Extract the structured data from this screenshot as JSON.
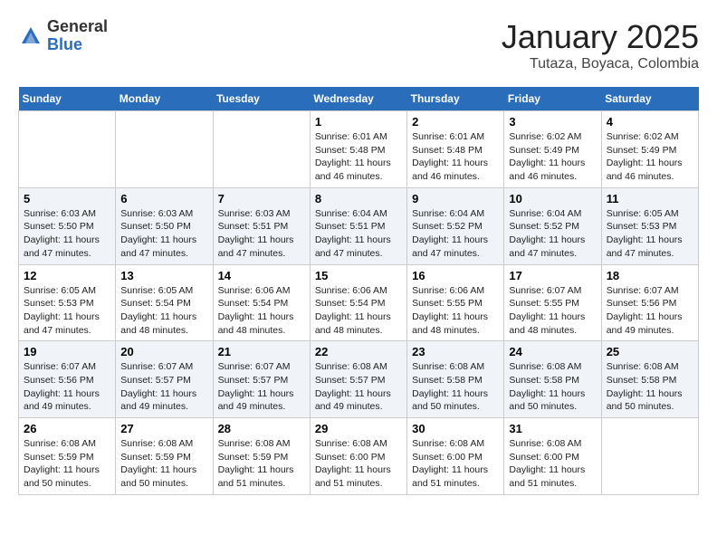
{
  "header": {
    "logo_general": "General",
    "logo_blue": "Blue",
    "month": "January 2025",
    "location": "Tutaza, Boyaca, Colombia"
  },
  "weekdays": [
    "Sunday",
    "Monday",
    "Tuesday",
    "Wednesday",
    "Thursday",
    "Friday",
    "Saturday"
  ],
  "weeks": [
    [
      {
        "day": "",
        "info": ""
      },
      {
        "day": "",
        "info": ""
      },
      {
        "day": "",
        "info": ""
      },
      {
        "day": "1",
        "info": "Sunrise: 6:01 AM\nSunset: 5:48 PM\nDaylight: 11 hours\nand 46 minutes."
      },
      {
        "day": "2",
        "info": "Sunrise: 6:01 AM\nSunset: 5:48 PM\nDaylight: 11 hours\nand 46 minutes."
      },
      {
        "day": "3",
        "info": "Sunrise: 6:02 AM\nSunset: 5:49 PM\nDaylight: 11 hours\nand 46 minutes."
      },
      {
        "day": "4",
        "info": "Sunrise: 6:02 AM\nSunset: 5:49 PM\nDaylight: 11 hours\nand 46 minutes."
      }
    ],
    [
      {
        "day": "5",
        "info": "Sunrise: 6:03 AM\nSunset: 5:50 PM\nDaylight: 11 hours\nand 47 minutes."
      },
      {
        "day": "6",
        "info": "Sunrise: 6:03 AM\nSunset: 5:50 PM\nDaylight: 11 hours\nand 47 minutes."
      },
      {
        "day": "7",
        "info": "Sunrise: 6:03 AM\nSunset: 5:51 PM\nDaylight: 11 hours\nand 47 minutes."
      },
      {
        "day": "8",
        "info": "Sunrise: 6:04 AM\nSunset: 5:51 PM\nDaylight: 11 hours\nand 47 minutes."
      },
      {
        "day": "9",
        "info": "Sunrise: 6:04 AM\nSunset: 5:52 PM\nDaylight: 11 hours\nand 47 minutes."
      },
      {
        "day": "10",
        "info": "Sunrise: 6:04 AM\nSunset: 5:52 PM\nDaylight: 11 hours\nand 47 minutes."
      },
      {
        "day": "11",
        "info": "Sunrise: 6:05 AM\nSunset: 5:53 PM\nDaylight: 11 hours\nand 47 minutes."
      }
    ],
    [
      {
        "day": "12",
        "info": "Sunrise: 6:05 AM\nSunset: 5:53 PM\nDaylight: 11 hours\nand 47 minutes."
      },
      {
        "day": "13",
        "info": "Sunrise: 6:05 AM\nSunset: 5:54 PM\nDaylight: 11 hours\nand 48 minutes."
      },
      {
        "day": "14",
        "info": "Sunrise: 6:06 AM\nSunset: 5:54 PM\nDaylight: 11 hours\nand 48 minutes."
      },
      {
        "day": "15",
        "info": "Sunrise: 6:06 AM\nSunset: 5:54 PM\nDaylight: 11 hours\nand 48 minutes."
      },
      {
        "day": "16",
        "info": "Sunrise: 6:06 AM\nSunset: 5:55 PM\nDaylight: 11 hours\nand 48 minutes."
      },
      {
        "day": "17",
        "info": "Sunrise: 6:07 AM\nSunset: 5:55 PM\nDaylight: 11 hours\nand 48 minutes."
      },
      {
        "day": "18",
        "info": "Sunrise: 6:07 AM\nSunset: 5:56 PM\nDaylight: 11 hours\nand 49 minutes."
      }
    ],
    [
      {
        "day": "19",
        "info": "Sunrise: 6:07 AM\nSunset: 5:56 PM\nDaylight: 11 hours\nand 49 minutes."
      },
      {
        "day": "20",
        "info": "Sunrise: 6:07 AM\nSunset: 5:57 PM\nDaylight: 11 hours\nand 49 minutes."
      },
      {
        "day": "21",
        "info": "Sunrise: 6:07 AM\nSunset: 5:57 PM\nDaylight: 11 hours\nand 49 minutes."
      },
      {
        "day": "22",
        "info": "Sunrise: 6:08 AM\nSunset: 5:57 PM\nDaylight: 11 hours\nand 49 minutes."
      },
      {
        "day": "23",
        "info": "Sunrise: 6:08 AM\nSunset: 5:58 PM\nDaylight: 11 hours\nand 50 minutes."
      },
      {
        "day": "24",
        "info": "Sunrise: 6:08 AM\nSunset: 5:58 PM\nDaylight: 11 hours\nand 50 minutes."
      },
      {
        "day": "25",
        "info": "Sunrise: 6:08 AM\nSunset: 5:58 PM\nDaylight: 11 hours\nand 50 minutes."
      }
    ],
    [
      {
        "day": "26",
        "info": "Sunrise: 6:08 AM\nSunset: 5:59 PM\nDaylight: 11 hours\nand 50 minutes."
      },
      {
        "day": "27",
        "info": "Sunrise: 6:08 AM\nSunset: 5:59 PM\nDaylight: 11 hours\nand 50 minutes."
      },
      {
        "day": "28",
        "info": "Sunrise: 6:08 AM\nSunset: 5:59 PM\nDaylight: 11 hours\nand 51 minutes."
      },
      {
        "day": "29",
        "info": "Sunrise: 6:08 AM\nSunset: 6:00 PM\nDaylight: 11 hours\nand 51 minutes."
      },
      {
        "day": "30",
        "info": "Sunrise: 6:08 AM\nSunset: 6:00 PM\nDaylight: 11 hours\nand 51 minutes."
      },
      {
        "day": "31",
        "info": "Sunrise: 6:08 AM\nSunset: 6:00 PM\nDaylight: 11 hours\nand 51 minutes."
      },
      {
        "day": "",
        "info": ""
      }
    ]
  ]
}
